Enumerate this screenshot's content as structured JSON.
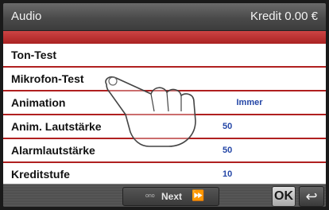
{
  "header": {
    "title": "Audio",
    "credit": "Kredit 0.00 €"
  },
  "menu": {
    "rows": [
      {
        "label": "Ton-Test",
        "value": ""
      },
      {
        "label": "Mikrofon-Test",
        "value": ""
      },
      {
        "label": "Animation",
        "value": "Immer"
      },
      {
        "label": "Anim. Lautstärke",
        "value": "50"
      },
      {
        "label": "Alarmlautstärke",
        "value": "50"
      },
      {
        "label": "Kreditstufe",
        "value": "10"
      }
    ]
  },
  "footer": {
    "next_small": "ono",
    "next_label": "Next",
    "next_icon": "fast-forward-icon",
    "ok_label": "OK",
    "back_icon": "back-arrow-icon"
  },
  "colors": {
    "header": "#4a4a4a",
    "row_separator": "#b02020",
    "value_text": "#2446a6",
    "row_background": "#ffffff"
  }
}
